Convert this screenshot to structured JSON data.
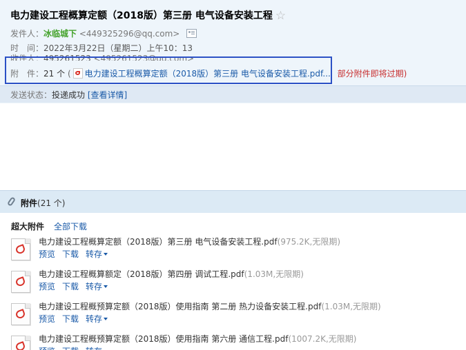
{
  "header": {
    "subject": "电力建设工程概算定额（2018版）第三册 电气设备安装工程",
    "star": "☆",
    "sender_label": "发件人：",
    "sender_name": "冰临城下",
    "sender_email": "<449325296@qq.com>",
    "time_label": "时　间：",
    "time_value": "2022年3月22日（星期二）上午10：13",
    "recipient_label": "收件人：",
    "recipient_name": "495261523",
    "recipient_email": "<495261523@qq.com>",
    "attach_label": "附　件：",
    "attach_count": "21 个",
    "attach_open_paren": "(",
    "attach_first_file": "电力建设工程概算定额（2018版）第三册 电气设备安装工程.pdf...",
    "attach_expire_note": "部分附件即将过期)"
  },
  "status": {
    "label": "发送状态：",
    "value": "投递成功",
    "detail_link": "[查看详情]"
  },
  "attachments": {
    "title": "附件",
    "count": "(21 个)",
    "section_label": "超大附件",
    "download_all": "全部下载",
    "actions": {
      "preview": "预览",
      "download": "下载",
      "forward": "转存"
    },
    "files": [
      {
        "name": "电力建设工程概算定额（2018版）第三册 电气设备安装工程.pdf",
        "size": "(975.2K,无限期)"
      },
      {
        "name": "电力建设工程概算额定（2018版）第四册 调试工程.pdf",
        "size": "(1.03M,无限期)"
      },
      {
        "name": "电力建设工程概预算定额（2018版）使用指南 第二册 热力设备安装工程.pdf",
        "size": "(1.03M,无限期)"
      },
      {
        "name": "电力建设工程概预算定额（2018版）使用指南 第六册 通信工程.pdf",
        "size": "(1007.2K,无限期)"
      }
    ]
  },
  "colors": {
    "header_bg": "#eef5fb",
    "status_bg": "#dfe9f4",
    "sender_green": "#44a22b",
    "link_blue": "#1a5aa8",
    "warning_red": "#c72b2b",
    "highlight_box": "#2b50c5"
  }
}
